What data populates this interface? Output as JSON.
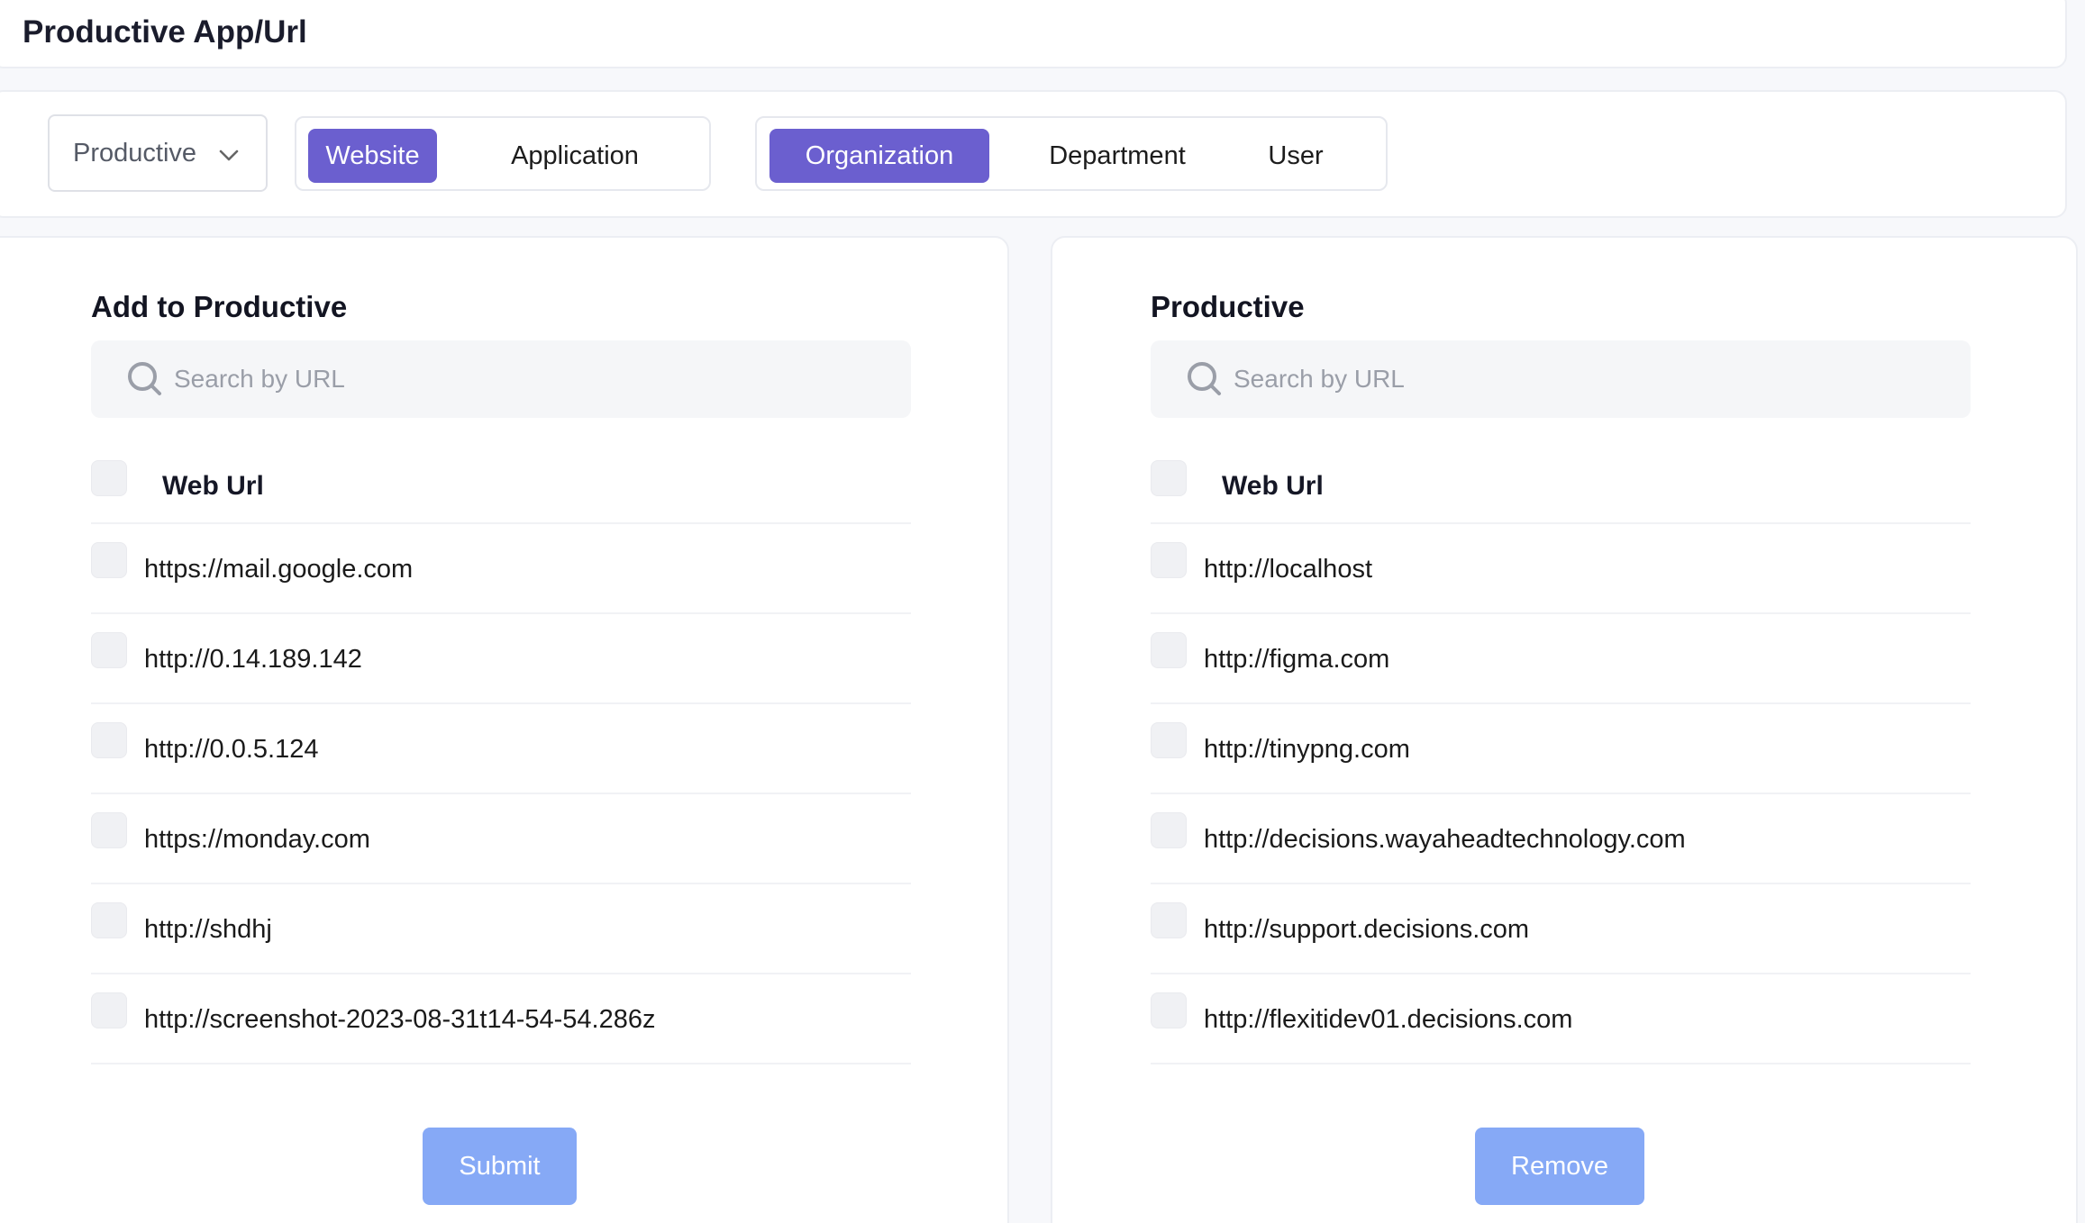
{
  "header": {
    "title": "Productive App/Url"
  },
  "filters": {
    "category_select": {
      "value": "Productive"
    },
    "type_tabs": [
      {
        "label": "Website",
        "active": true
      },
      {
        "label": "Application",
        "active": false
      }
    ],
    "scope_tabs": [
      {
        "label": "Organization",
        "active": true
      },
      {
        "label": "Department",
        "active": false
      },
      {
        "label": "User",
        "active": false
      }
    ]
  },
  "left_panel": {
    "title": "Add to Productive",
    "search": {
      "placeholder": "Search by URL",
      "value": ""
    },
    "column_header": "Web Url",
    "rows": [
      "https://mail.google.com",
      "http://0.14.189.142",
      "http://0.0.5.124",
      "https://monday.com",
      "http://shdhj",
      "http://screenshot-2023-08-31t14-54-54.286z"
    ],
    "button_label": "Submit"
  },
  "right_panel": {
    "title": "Productive",
    "search": {
      "placeholder": "Search by URL",
      "value": ""
    },
    "column_header": "Web Url",
    "rows": [
      "http://localhost",
      "http://figma.com",
      "http://tinypng.com",
      "http://decisions.wayaheadtechnology.com",
      "http://support.decisions.com",
      "http://flexitidev01.decisions.com"
    ],
    "button_label": "Remove"
  },
  "colors": {
    "accent": "#6b5fcf",
    "button_disabled": "#86a9f6",
    "background": "#f7f8fb"
  },
  "icons": {
    "select_chevron": "chevron-down-icon",
    "search": "search-icon"
  }
}
